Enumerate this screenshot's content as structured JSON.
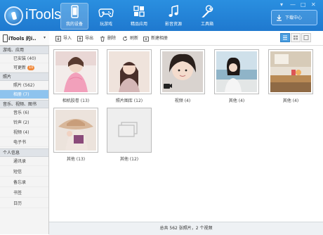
{
  "app": {
    "brand": "iTools",
    "window_controls": [
      "▾",
      "—",
      "□",
      "✕"
    ]
  },
  "nav": [
    {
      "label": "我的设备",
      "icon": "device-icon",
      "active": true
    },
    {
      "label": "玩游戏",
      "icon": "gamepad-icon",
      "active": false
    },
    {
      "label": "精品应用",
      "icon": "apps-grid-icon",
      "active": false
    },
    {
      "label": "影音资源",
      "icon": "music-note-icon",
      "active": false
    },
    {
      "label": "工具箱",
      "icon": "wrench-icon",
      "active": false
    }
  ],
  "download_center": {
    "label": "下载中心",
    "icon": "download-icon"
  },
  "device": {
    "name": "iTools 的i..",
    "arrow": "▾"
  },
  "sidebar": {
    "sections": [
      {
        "title": "游戏、应用",
        "items": [
          {
            "label": "已安装 (40)"
          },
          {
            "label": "可更新",
            "badge": "10"
          }
        ]
      },
      {
        "title": "照片",
        "items": [
          {
            "label": "照片 (562)"
          },
          {
            "label": "相册 (7)",
            "selected": true
          }
        ]
      },
      {
        "title": "音乐、视频、图书",
        "items": [
          {
            "label": "音乐 (6)"
          },
          {
            "label": "铃声 (2)"
          },
          {
            "label": "视频 (4)"
          },
          {
            "label": "电子书"
          }
        ]
      },
      {
        "title": "个人信息",
        "items": [
          {
            "label": "通讯录"
          },
          {
            "label": "短信"
          },
          {
            "label": "备忘录"
          },
          {
            "label": "书签"
          },
          {
            "label": "日历"
          }
        ]
      }
    ]
  },
  "toolbar": {
    "import": "导入",
    "export": "导出",
    "delete": "删除",
    "refresh": "刷新",
    "new_album": "新建相册"
  },
  "albums": [
    {
      "caption": "相机胶卷 (13)",
      "scene": "pink"
    },
    {
      "caption": "照片图库 (12)",
      "scene": "girl2"
    },
    {
      "caption": "视频 (4)",
      "scene": "video"
    },
    {
      "caption": "其他 (4)",
      "scene": "sea"
    },
    {
      "caption": "其他 (4)",
      "scene": "kitchen"
    },
    {
      "caption": "其他 (13)",
      "scene": "hat"
    },
    {
      "caption": "其他 (12)",
      "scene": "blank"
    }
  ],
  "status": "总共 562 张照片，2 个视频",
  "colors": {
    "header": "#2384d8",
    "selected": "#8ec3ee",
    "badge": "#f0883a"
  }
}
